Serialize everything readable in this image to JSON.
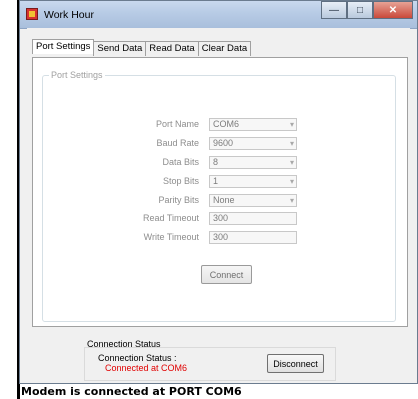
{
  "window": {
    "title": "Work Hour",
    "controls": {
      "minimize": "—",
      "maximize": "□",
      "close": "✕"
    }
  },
  "tabs": [
    "Port Settings",
    "Send Data",
    "Read Data",
    "Clear Data"
  ],
  "port_settings": {
    "group_title": "Port Settings",
    "fields": [
      {
        "label": "Port Name",
        "value": "COM6",
        "type": "combo"
      },
      {
        "label": "Baud Rate",
        "value": "9600",
        "type": "combo"
      },
      {
        "label": "Data Bits",
        "value": "8",
        "type": "combo"
      },
      {
        "label": "Stop Bits",
        "value": "1",
        "type": "combo"
      },
      {
        "label": "Parity Bits",
        "value": "None",
        "type": "combo"
      },
      {
        "label": "Read Timeout",
        "value": "300",
        "type": "text"
      },
      {
        "label": "Write Timeout",
        "value": "300",
        "type": "text"
      }
    ],
    "connect_label": "Connect"
  },
  "connection_status": {
    "group_title": "Connection Status",
    "label": "Connection Status :",
    "value": "Connected at COM6",
    "disconnect_label": "Disconnect"
  },
  "bottom_message": "Modem is connected at PORT COM6",
  "colors": {
    "status_connected": "#e00000",
    "titlebar": "#b7cbe5",
    "disabled_text": "#8d8d8d"
  }
}
